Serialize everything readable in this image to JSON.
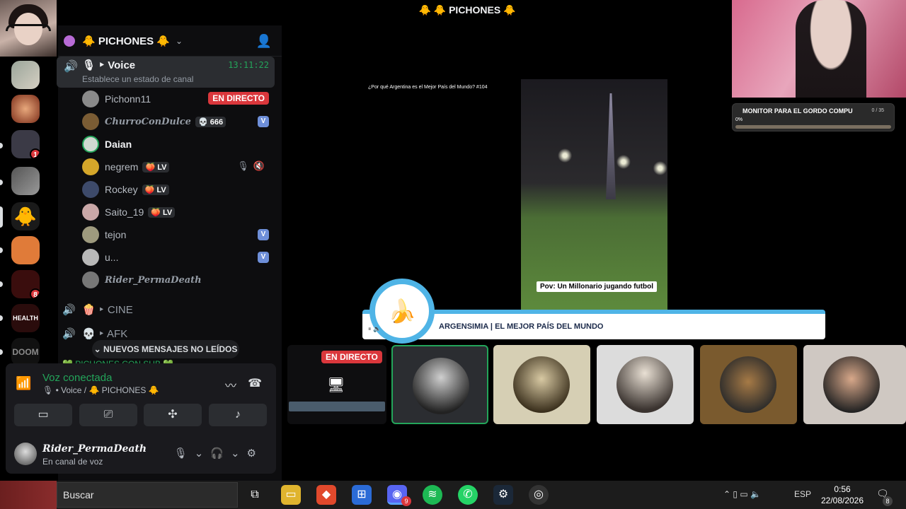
{
  "window_title": "🐥 🐥 PICHONES 🐥",
  "server": {
    "name": "🐥 PICHONES 🐥"
  },
  "rail": {
    "badges": [
      "1",
      "8"
    ],
    "health_label": "HEALTH",
    "doom_label": "DOOM"
  },
  "voice_channel": {
    "name": "🎙 ‣ Voice",
    "timer": "13:11:22",
    "status_placeholder": "Establece un estado de canal"
  },
  "members": [
    {
      "name": "Pichonn11",
      "live": "EN DIRECTO"
    },
    {
      "name": "ChurroConDulce",
      "tag": "💀 666",
      "badge": "V"
    },
    {
      "name": "Daian"
    },
    {
      "name": "negrem",
      "tag": "🍑 LV",
      "mutes": "🎙🔇"
    },
    {
      "name": "Rockey",
      "tag": "🍑 LV"
    },
    {
      "name": "Saito_19",
      "tag": "🍑 LV"
    },
    {
      "name": "tejon",
      "badge": "V"
    },
    {
      "name": "u...",
      "badge": "V"
    },
    {
      "name": "Rider_PermaDeath"
    }
  ],
  "channels": [
    {
      "name": "🍿 ‣ CINE"
    },
    {
      "name": "💀 ‣ AFK"
    }
  ],
  "new_messages_label": "NUEVOS MENSAJES NO LEÍDOS",
  "peek_text": "💚 PICHONES CON SUB 💚",
  "voice_panel": {
    "title": "Voz conectada",
    "subtitle": "🎙 • Voice / 🐥 PICHONES 🐥"
  },
  "user": {
    "name": "Rider_PermaDeath",
    "status": "En canal de voz"
  },
  "stream": {
    "video_title": "¿Por qué Argentina es el Mejor País del Mundo? #104",
    "caption": "Pov: Un Millonario jugando futbol",
    "banner_text": "ARGENSIMIA | EL MEJOR PAÍS DEL MUNDO"
  },
  "goal": {
    "title": "MONITOR PARA EL GORDO COMPU",
    "count": "0 / 35",
    "percent": "0%",
    "progress": 0.0
  },
  "live_tile_label": "EN DIRECTO",
  "taskbar": {
    "search_placeholder": "Buscar",
    "lang": "ESP",
    "time": "0:56",
    "date": "22/08/2026",
    "discord_badge": "9",
    "notif_badge": "8"
  }
}
